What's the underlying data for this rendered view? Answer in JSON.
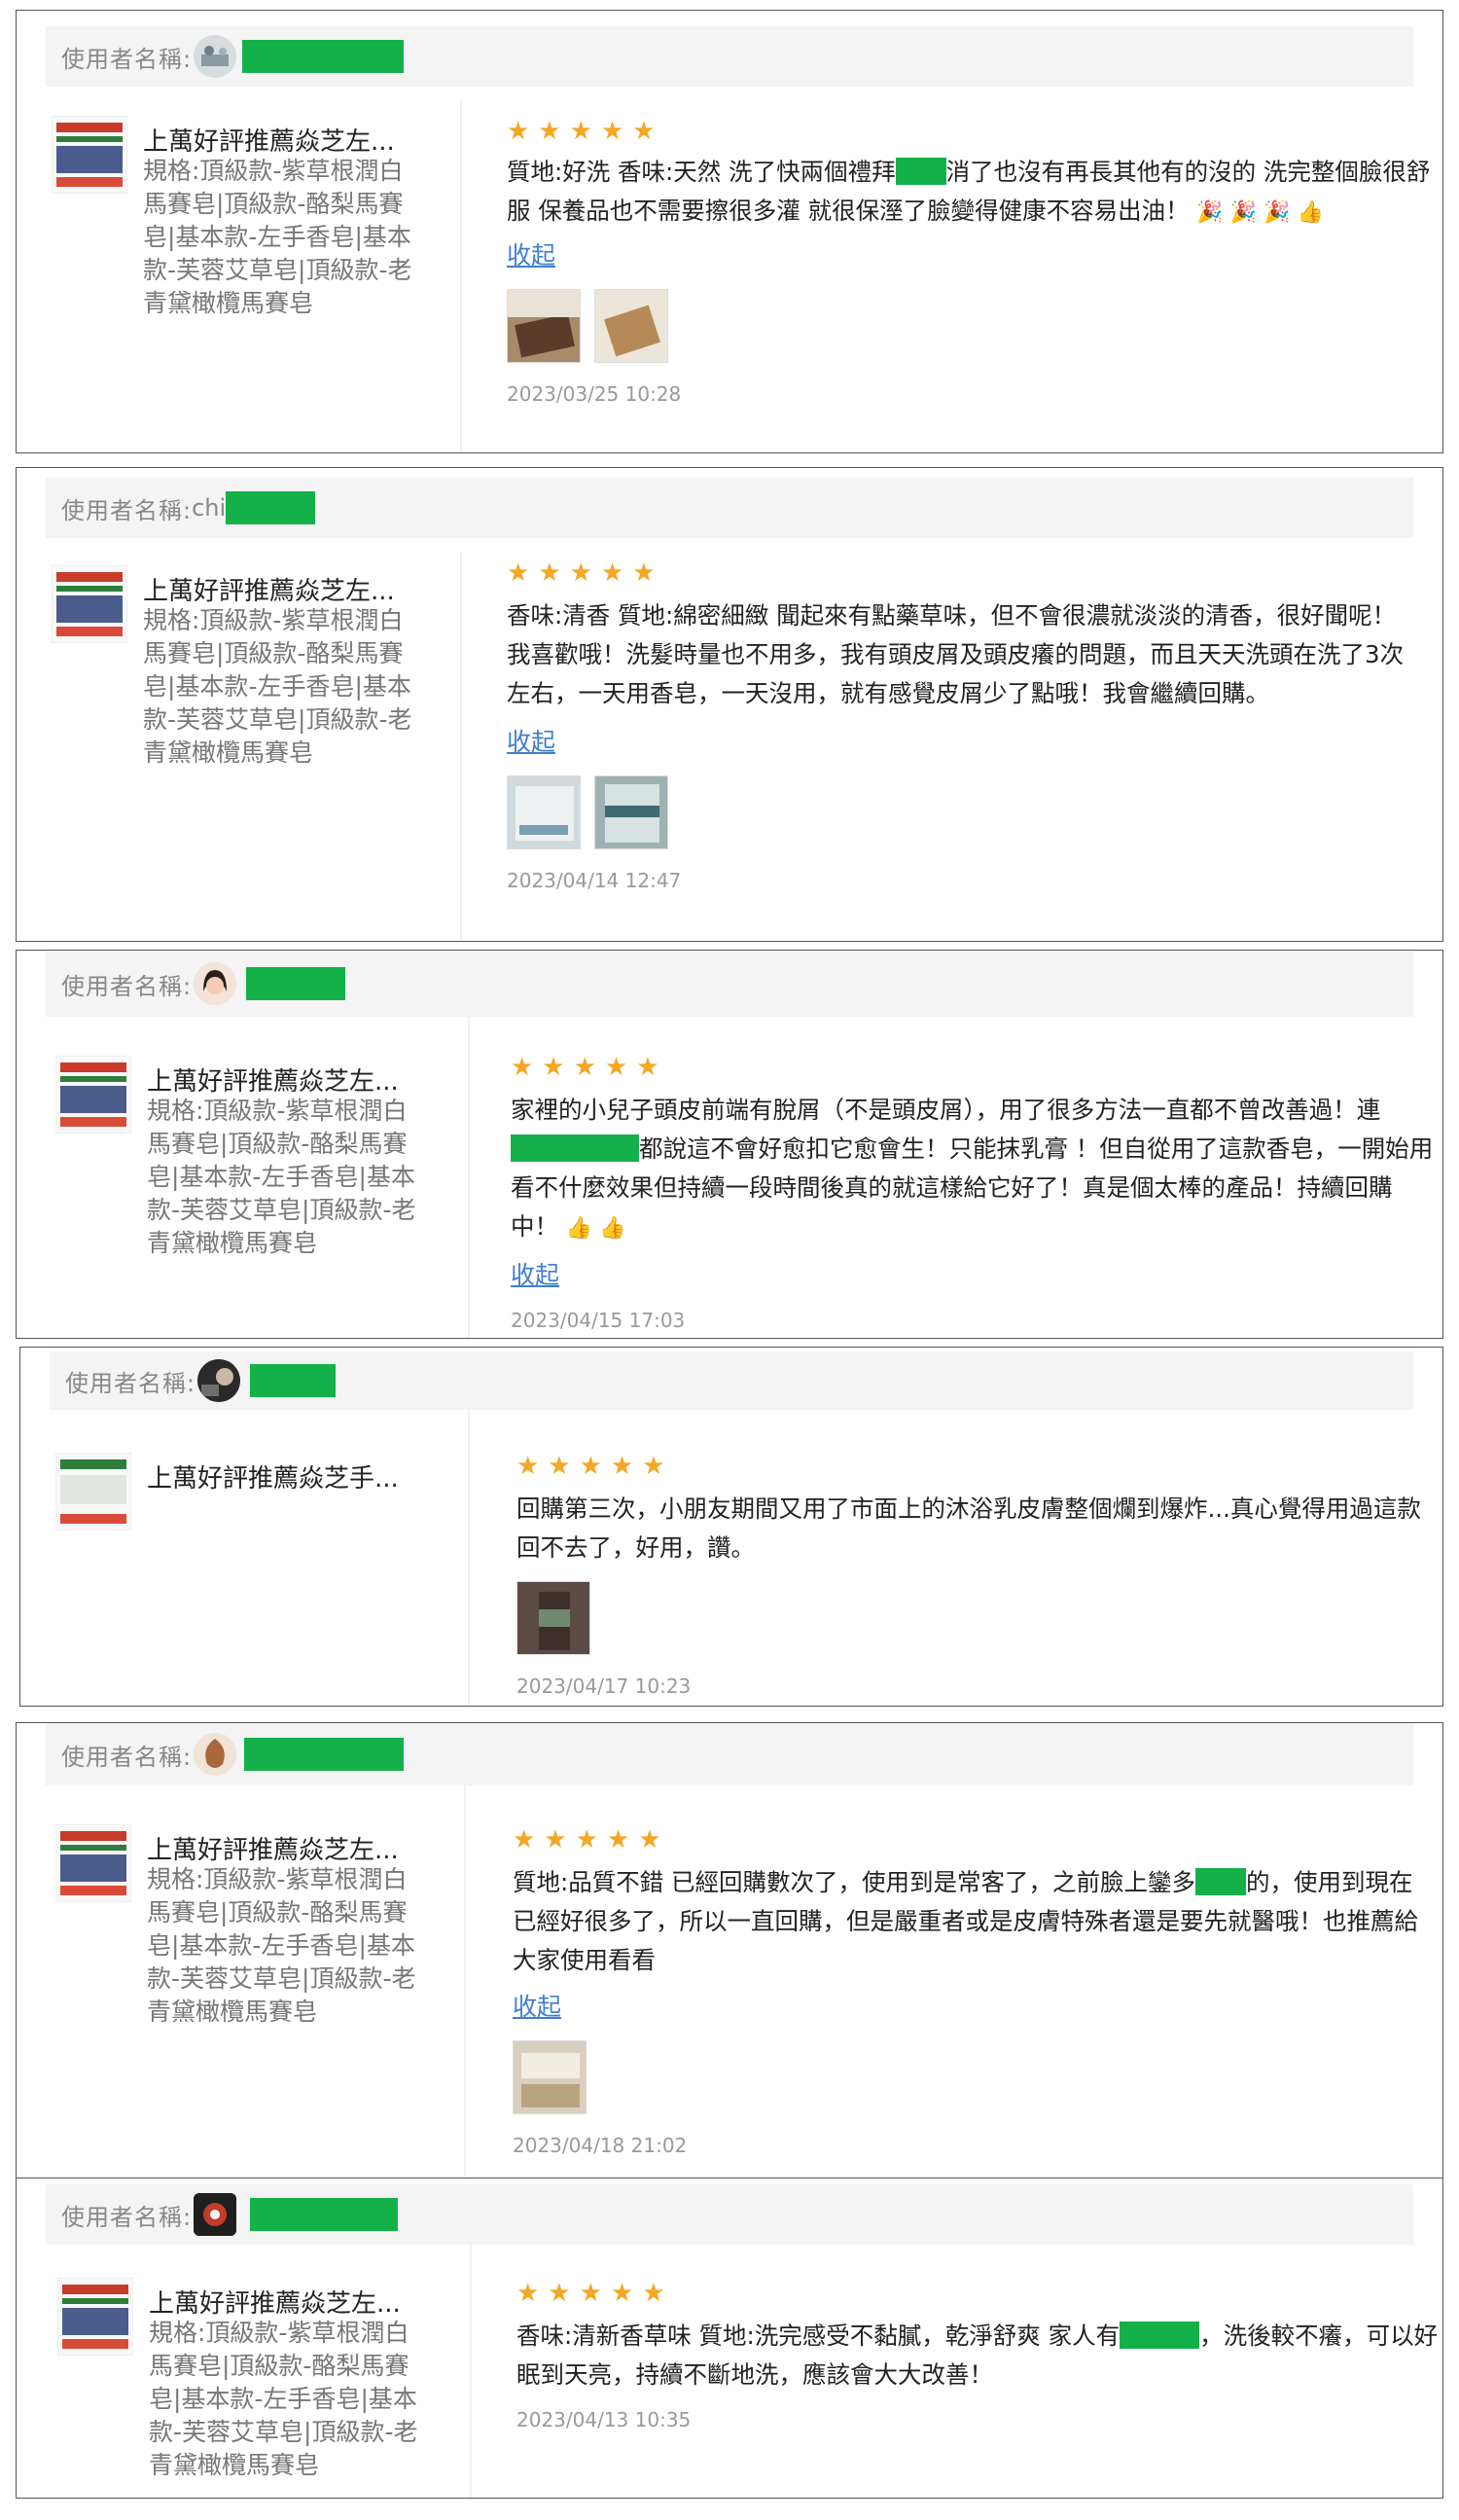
{
  "user_label": "使用者名稱:",
  "collapse_label": "收起",
  "product_title": "上萬好評推薦焱芝左...",
  "product_spec": "規格:頂級款-紫草根潤白馬賽皂|頂級款-酪梨馬賽皂|基本款-左手香皂|基本款-芙蓉艾草皂|頂級款-老青黛橄欖馬賽皂",
  "stars": "★★★★★",
  "colors": {
    "mask": "#14b14a",
    "star": "#f5a623",
    "link": "#3f7ecf"
  },
  "reviews": [
    {
      "username": "",
      "text_a": "質地:好洗 香味:天然 洗了快兩個禮拜",
      "text_b": "消了也沒有再長其他有的沒的 洗完整個臉很舒服 保養品也不需要擦很多灌 就很保溼了臉變得健康不容易出油！",
      "emoji": "🎉 🎉 🎉 👍",
      "date": "2023/03/25 10:28"
    },
    {
      "username": "chi",
      "text_a": "香味:清香 質地:綿密細緻 聞起來有點藥草味，但不會很濃就淡淡的清香，很好聞呢！我喜歡哦！洗髮時量也不用多，我有頭皮屑及頭皮癢的問題，而且天天洗頭在洗了3次左右，一天用香皂，一天沒用，就有感覺皮屑少了點哦！我會繼續回購。",
      "date": "2023/04/14 12:47"
    },
    {
      "username": "",
      "text_a": "家裡的小兒子頭皮前端有脫屑（不是頭皮屑），用了很多方法一直都不曾改善過！連",
      "text_b": "都說這不會好愈扣它愈會生！只能抹乳膏 ！但自從用了這款香皂，一開始用看不什麼效果但持續一段時間後真的就這樣給它好了！真是個太棒的產品！持續回購中！",
      "emoji": "👍 👍",
      "date": "2023/04/15 17:03"
    },
    {
      "username": "",
      "product_title": "上萬好評推薦焱芝手...",
      "text_a": "回購第三次，小朋友期間又用了市面上的沐浴乳皮膚整個爛到爆炸...真心覺得用過這款回不去了，好用，讚。",
      "date": "2023/04/17 10:23"
    },
    {
      "username": "",
      "text_a": "質地:品質不錯 已經回購數次了，使用到是常客了，之前臉上鑾多",
      "text_b": "的，使用到現在已經好很多了，所以一直回購，但是嚴重者或是皮膚特殊者還是要先就醫哦！也推薦給大家使用看看",
      "date": "2023/04/18 21:02"
    },
    {
      "username": "",
      "text_a": "香味:清新香草味 質地:洗完感受不黏膩，乾淨舒爽 家人有",
      "text_b": "，洗後較不癢，可以好眠到天亮，持續不斷地洗，應該會大大改善！",
      "date": "2023/04/13 10:35"
    }
  ]
}
